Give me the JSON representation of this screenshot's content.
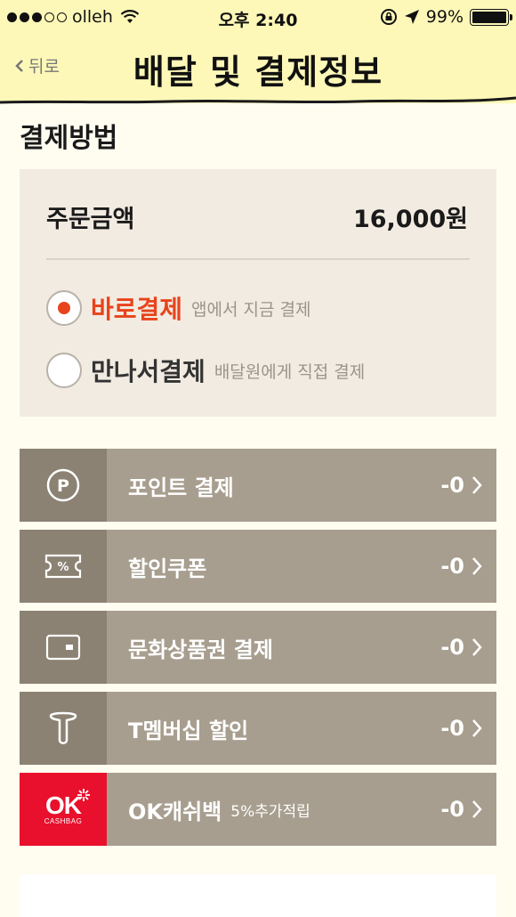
{
  "status_bar": {
    "carrier": "olleh",
    "time": "오후 2:40",
    "battery": "99%",
    "battery_level": 0.99
  },
  "nav": {
    "back_label": "뒤로",
    "title": "배달 및 결제정보"
  },
  "payment": {
    "section_title": "결제방법",
    "amount_label": "주문금액",
    "amount_value": "16,000원",
    "methods": [
      {
        "label": "바로결제",
        "desc": "앱에서 지금 결제",
        "selected": true,
        "color": "#e8431c"
      },
      {
        "label": "만나서결제",
        "desc": "배달원에게 직접 결제",
        "selected": false,
        "color": "#333333"
      }
    ]
  },
  "options": [
    {
      "icon": "point-icon",
      "label": "포인트 결제",
      "value": "-0"
    },
    {
      "icon": "coupon-icon",
      "label": "할인쿠폰",
      "value": "-0"
    },
    {
      "icon": "gift-card-icon",
      "label": "문화상품권 결제",
      "value": "-0"
    },
    {
      "icon": "t-membership-icon",
      "label": "T멤버십 할인",
      "value": "-0"
    },
    {
      "icon": "ok-cashbag-icon",
      "label": "OK캐쉬백",
      "sub": "5%추가적립",
      "value": "-0",
      "icon_text": "OK",
      "icon_subtext": "CASHBAG"
    }
  ],
  "colors": {
    "header_bg": "#fef8b8",
    "page_bg": "#fffdf0",
    "option_bg": "#a79e8f",
    "option_icon_bg": "#8b8273",
    "accent": "#e8431c",
    "ok_cashbag_red": "#e8102c"
  }
}
